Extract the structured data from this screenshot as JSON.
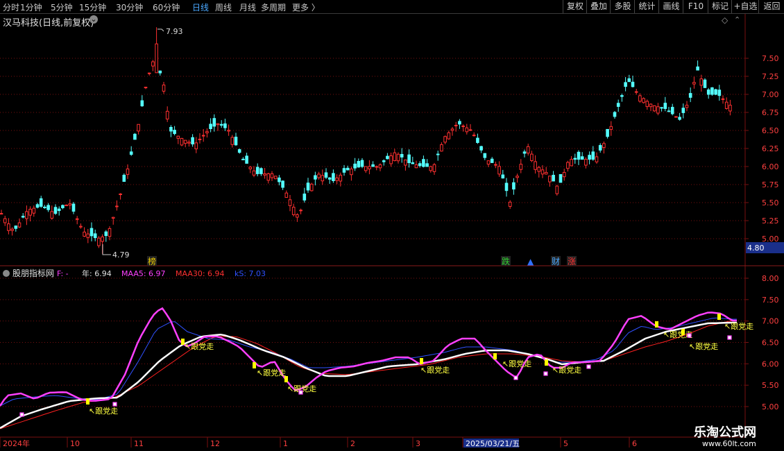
{
  "toolbar": {
    "periods": [
      "分时",
      "1分钟",
      "5分钟",
      "15分钟",
      "30分钟",
      "60分钟",
      "日线",
      "周线",
      "月线",
      "多周期",
      "更多"
    ],
    "active_period": "日线",
    "right_buttons": [
      "复权",
      "叠加",
      "多股",
      "统计",
      "画线",
      "F10",
      "标记",
      "+自选",
      "返回"
    ]
  },
  "main_panel": {
    "title": "汉马科技(日线,前复权)",
    "price_axis_ticks": [
      "7.50",
      "7.25",
      "7.00",
      "6.75",
      "6.50",
      "6.25",
      "6.00",
      "5.75",
      "5.50",
      "5.25",
      "5.00"
    ],
    "high_label": "7.93",
    "low_label": "4.79",
    "current_price_tag": "4.80",
    "event_markers": [
      {
        "text": "榜",
        "color": "#e8c800"
      },
      {
        "text": "跌",
        "color": "#30d030"
      },
      {
        "text": "▲",
        "color": "#3070ff"
      },
      {
        "text": "财",
        "color": "#4aa8ff"
      },
      {
        "text": "涨",
        "color": "#ff3030"
      }
    ]
  },
  "indicator_panel": {
    "name": "股朋指标网",
    "legend": [
      {
        "text": "F: -",
        "color": "#ff40ff"
      },
      {
        "text": "年: 6.94",
        "color": "#e0e0e0"
      },
      {
        "text": "MAA5: 6.97",
        "color": "#ff40ff"
      },
      {
        "text": "MAA30: 6.94",
        "color": "#ff3030"
      },
      {
        "text": "kS: 7.03",
        "color": "#3050ff"
      }
    ],
    "axis_ticks": [
      "8.00",
      "7.50",
      "7.00",
      "6.50",
      "6.00",
      "5.50",
      "5.00"
    ],
    "signal_text": "跟党走"
  },
  "date_axis": {
    "labels": [
      "2024年",
      "10",
      "11",
      "12",
      "1",
      "2",
      "3",
      "2025/03/21/五",
      "5",
      "6"
    ]
  },
  "watermark": {
    "title": "乐淘公式网",
    "url": "www.60lt.com"
  },
  "colors": {
    "up": "#ff3030",
    "down": "#54ffff",
    "grid": "#7a1010",
    "axis_text": "#ff4040",
    "white_line": "#ffffff",
    "magenta_line": "#ff40ff",
    "blue_line": "#3050ff",
    "red_line": "#ff2020",
    "yellow_mark": "#ffff00"
  }
}
